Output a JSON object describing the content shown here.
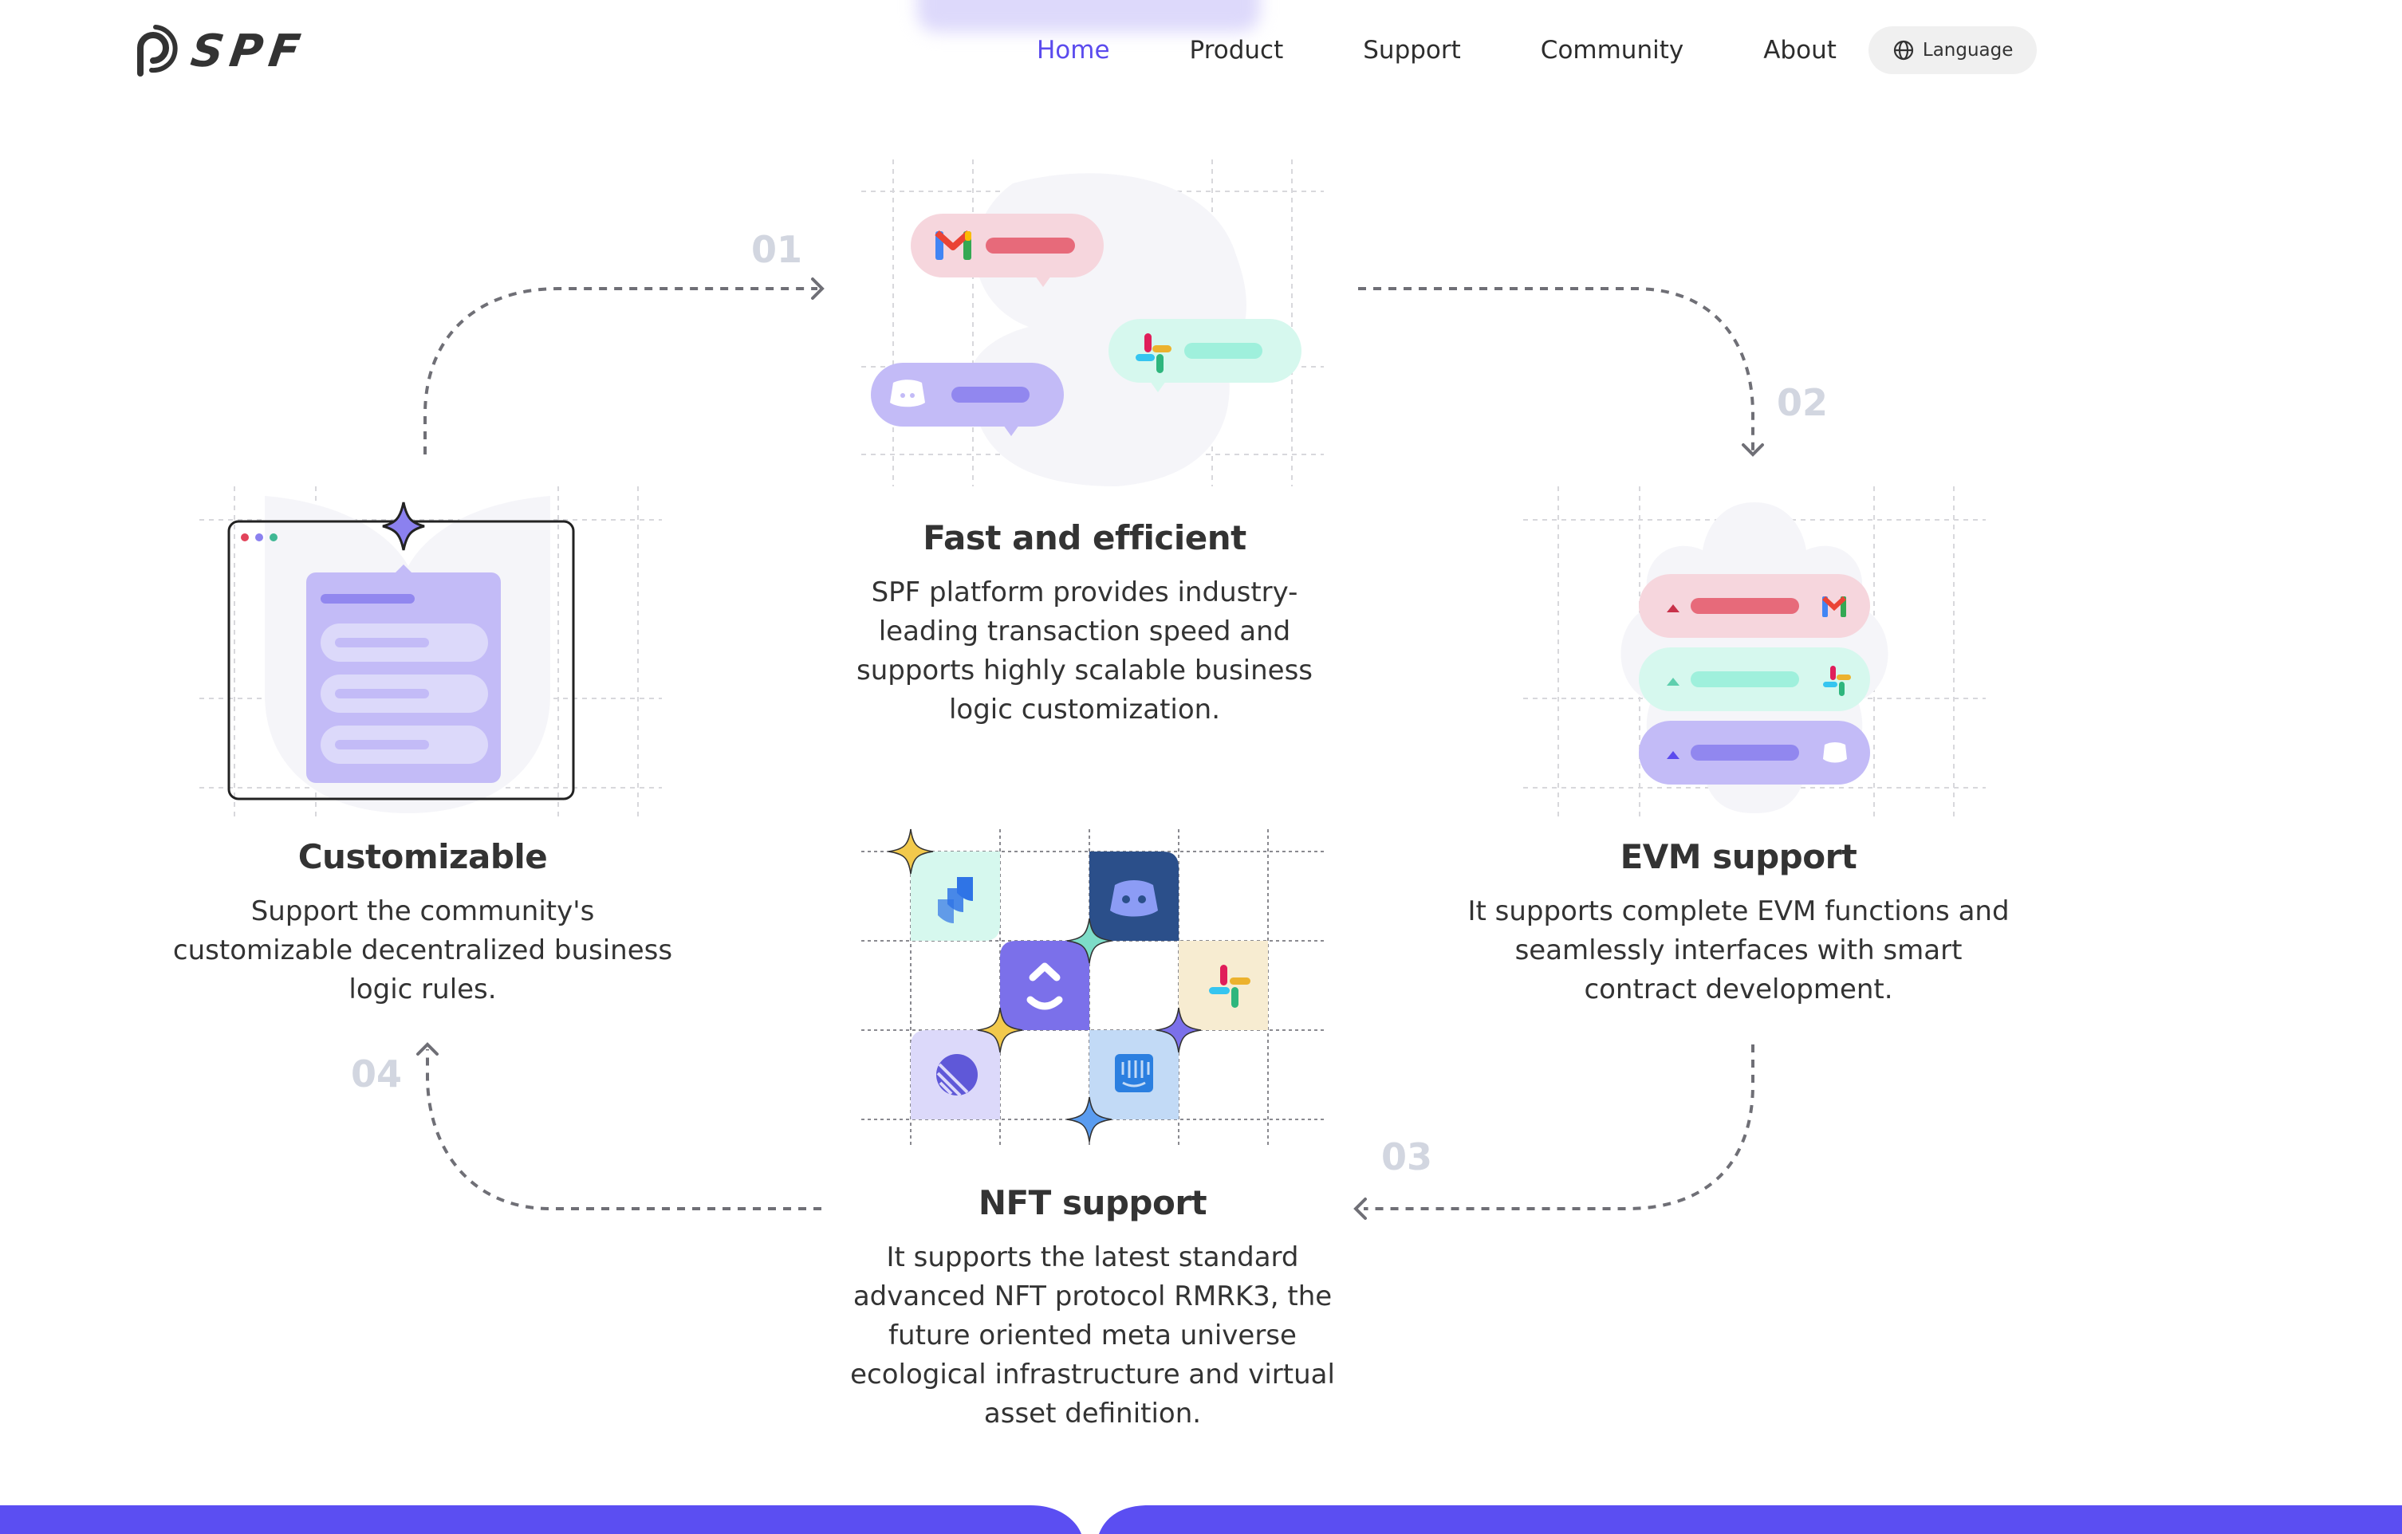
{
  "header": {
    "brand": "SPF",
    "nav": [
      {
        "label": "Home",
        "active": true
      },
      {
        "label": "Product",
        "active": false
      },
      {
        "label": "Support",
        "active": false
      },
      {
        "label": "Community",
        "active": false
      },
      {
        "label": "About",
        "active": false
      }
    ],
    "language_button": {
      "label": "Language",
      "icon": "globe-icon"
    }
  },
  "steps": [
    {
      "number": "01",
      "title": "Fast and efficient",
      "description": "SPF platform provides industry-leading transaction speed and supports highly scalable business logic customization.",
      "illustration_icons": [
        "gmail-icon",
        "slack-icon",
        "discord-icon"
      ]
    },
    {
      "number": "02",
      "title": "EVM support",
      "description": "It supports complete EVM functions and seamlessly interfaces with smart contract development.",
      "illustration_icons": [
        "gmail-icon",
        "slack-icon",
        "discord-icon"
      ]
    },
    {
      "number": "03",
      "title": "NFT support",
      "description": "It supports the latest standard advanced NFT protocol RMRK3, the future oriented meta universe ecological infrastructure and virtual asset definition.",
      "illustration_icons": [
        "jira-icon",
        "discord-icon",
        "clickup-icon",
        "slack-icon",
        "linear-icon",
        "intercom-icon"
      ]
    },
    {
      "number": "04",
      "title": "Customizable",
      "description": "Support the community's customizable decentralized business logic rules.",
      "illustration_icons": [
        "window-icon",
        "sparkle-icon"
      ]
    }
  ],
  "colors": {
    "accent": "#5b4bee",
    "footer_band": "#5b4ef2",
    "step_number": "#d2d6e0",
    "text": "#333333",
    "pink": "#f6d6dd",
    "mint": "#d6f8ee",
    "lavender": "#c3bbf7"
  }
}
